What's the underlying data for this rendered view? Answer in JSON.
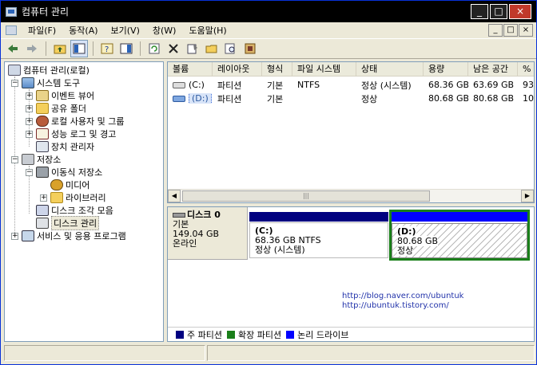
{
  "window": {
    "title": "컴퓨터 관리",
    "buttons": [
      "_",
      "□",
      "×"
    ]
  },
  "menu": {
    "items": [
      "파일(F)",
      "동작(A)",
      "보기(V)",
      "창(W)",
      "도움말(H)"
    ],
    "mdi_buttons": [
      "_",
      "□",
      "×"
    ]
  },
  "tree": {
    "root": "컴퓨터 관리(로컬)",
    "system_tools": "시스템 도구",
    "event_viewer": "이벤트 뷰어",
    "shared_folders": "공유 폴더",
    "local_users": "로컬 사용자 및 그룹",
    "perf_logs": "성능 로그 및 경고",
    "device_manager": "장치 관리자",
    "storage": "저장소",
    "removable": "이동식 저장소",
    "media": "미디어",
    "library": "라이브러리",
    "defrag": "디스크 조각 모음",
    "disk_management": "디스크 관리",
    "services": "서비스 및 응용 프로그램"
  },
  "volume_list": {
    "columns": [
      "볼륨",
      "레이아웃",
      "형식",
      "파일 시스템",
      "상태",
      "용량",
      "남은 공간",
      "%"
    ],
    "rows": [
      {
        "volume": "(C:)",
        "layout": "파티션",
        "type": "기본",
        "fs": "NTFS",
        "status": "정상 (시스템)",
        "capacity": "68.36 GB",
        "free": "63.69 GB",
        "pct": "93"
      },
      {
        "volume": "(D:)",
        "layout": "파티션",
        "type": "기본",
        "fs": "",
        "status": "정상",
        "capacity": "80.68 GB",
        "free": "80.68 GB",
        "pct": "10"
      }
    ],
    "scroll_left": "◀",
    "scroll_right": "▶",
    "scroll_grip": "|||"
  },
  "disk": {
    "name": "디스크 0",
    "type": "기본",
    "size": "149.04 GB",
    "state": "온라인",
    "partitions": [
      {
        "label": "(C:)",
        "size": "68.36 GB NTFS",
        "status": "정상 (시스템)"
      },
      {
        "label": "(D:)",
        "size": "80.68 GB",
        "status": "정상"
      }
    ]
  },
  "urls": [
    "http://blog.naver.com/ubuntuk",
    "http://ubuntuk.tistory.com/"
  ],
  "legend": [
    {
      "label": "주 파티션",
      "color": "#000080"
    },
    {
      "label": "확장 파티션",
      "color": "#1a7f1a"
    },
    {
      "label": "논리 드라이브",
      "color": "#0000ff"
    }
  ]
}
